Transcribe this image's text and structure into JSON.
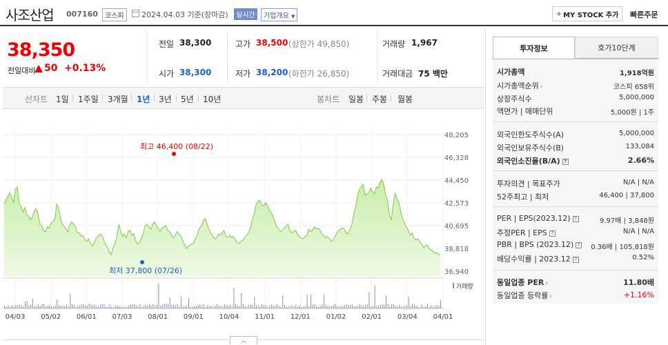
{
  "header": {
    "company_name": "사조산업",
    "code": "007160",
    "market": "코스피",
    "date_text": "2024.04.03  기준(장마감)",
    "realtime_label": "실시간",
    "overview_label": "기업개요",
    "mystock_label": "MY STOCK 추가",
    "quick_order_label": "빠른주문"
  },
  "price": {
    "current": "38,350",
    "change_label": "전일대비",
    "change_value": "50",
    "change_pct": "+0.13%"
  },
  "quote": {
    "prev_label": "전일",
    "prev": "38,300",
    "high_label": "고가",
    "high": "38,500",
    "upper_limit": "(상한가 49,850)",
    "volume_label": "거래량",
    "volume": "1,967",
    "open_label": "시가",
    "open": "38,300",
    "low_label": "저가",
    "low": "38,200",
    "lower_limit": "(하한가 26,850)",
    "amount_label": "거래대금",
    "amount": "75 백만"
  },
  "period": {
    "line_chart_label": "선차트",
    "line_items": [
      "1일",
      "1주일",
      "3개월",
      "1년",
      "3년",
      "5년",
      "10년"
    ],
    "selected": "1년",
    "candle_label": "봉차트",
    "candle_items": [
      "일봉",
      "주봉",
      "월봉"
    ]
  },
  "chart_data": {
    "type": "area",
    "y_ticks": [
      "48,205",
      "46,328",
      "44,450",
      "42,573",
      "40,695",
      "38,818",
      "36,940"
    ],
    "ylim": [
      36940,
      48205
    ],
    "x_ticks": [
      "04/03",
      "05/02",
      "06/01",
      "07/03",
      "08/01",
      "09/01",
      "10/04",
      "11/01",
      "12/01",
      "01/02",
      "02/01",
      "03/04",
      "04/01"
    ],
    "high_annotation": "최고 46,400 (08/22)",
    "low_annotation": "최저 37,800 (07/26)",
    "volume_label": "거래량",
    "series": [
      {
        "name": "price",
        "values": [
          42500,
          42800,
          43100,
          43400,
          43000,
          42600,
          43700,
          43900,
          42500,
          42300,
          41800,
          42200,
          41600,
          41500,
          41200,
          41400,
          41900,
          42100,
          41700,
          40800,
          40700,
          40300,
          40200,
          40600,
          40500,
          40900,
          41000,
          41300,
          42500,
          42100,
          41300,
          40800,
          40600,
          40400,
          40200,
          40800,
          41000,
          40800,
          40600,
          40100,
          40100,
          39800,
          39900,
          39500,
          39400,
          39600,
          39200,
          39000,
          39300,
          39700,
          39800,
          40000,
          39900,
          39500,
          39100,
          38900,
          38500,
          38300,
          38900,
          39200,
          39800,
          40800,
          40200,
          39800,
          40000,
          39700,
          40200,
          40300,
          39900,
          40000,
          39400,
          39200,
          39300,
          39600,
          40100,
          40700,
          40800,
          40600,
          40400,
          40800,
          41000,
          40700,
          40400,
          40200,
          40500,
          40600,
          40700,
          40300,
          40200,
          39900,
          39700,
          39900,
          40200,
          40000,
          39800,
          39500,
          39100,
          38800,
          39000,
          39100,
          39200,
          39300,
          39700,
          40100,
          40500,
          40700,
          41100,
          41300,
          40800,
          40400,
          40100,
          39800,
          39600,
          39700,
          40000,
          39900,
          40100,
          40300,
          39800,
          39700,
          39900,
          39700,
          39800,
          39500,
          39300,
          39200,
          39400,
          39500,
          39700,
          39900,
          40100,
          40500,
          41200,
          41600,
          42400,
          42700,
          42800,
          42400,
          42300,
          42600,
          42400,
          42000,
          41800,
          41500,
          41000,
          40600,
          40400,
          40200,
          40300,
          40500,
          40700,
          40800,
          40300,
          40100,
          40200,
          40300,
          40000,
          39800,
          39700,
          39600,
          39800,
          39900,
          40400,
          40200,
          40300,
          40600,
          40400,
          40500,
          40300,
          40000,
          39900,
          39700,
          39800,
          39600,
          39400,
          39500,
          39800,
          40100,
          40300,
          40400,
          40500,
          40400,
          40100,
          40000,
          40400,
          40800,
          41700,
          42200,
          43200,
          43700,
          43900,
          44100,
          43200,
          43300,
          43400,
          43800,
          43500,
          43300,
          43900,
          43800,
          44300,
          44500,
          44000,
          43200,
          42700,
          41500,
          41200,
          42500,
          43400,
          42900,
          42600,
          41800,
          41300,
          40900,
          40600,
          40300,
          39900,
          40100,
          39700,
          39500,
          39600,
          39400,
          39200,
          38900,
          39000,
          39100,
          38800,
          38700,
          38600,
          38400,
          38500,
          38300,
          38350
        ]
      }
    ]
  },
  "info": {
    "tab_invest": "투자정보",
    "tab_hoga": "호가10단계",
    "mktcap_label": "시가총액",
    "mktcap": "1,918억원",
    "mktcap_rank_label": "시가총액순위",
    "mktcap_rank": "코스피 658위",
    "shares_label": "상장주식수",
    "shares": "5,000,000",
    "par_label": "액면가 | 매매단위",
    "par": "5,000원 | 1주",
    "foreign_limit_label": "외국인한도주식수(A)",
    "foreign_limit": "5,000,000",
    "foreign_hold_label": "외국인보유주식수(B)",
    "foreign_hold": "133,084",
    "foreign_rate_label": "외국인소진율(B/A)",
    "foreign_rate": "2.66%",
    "opinion_label": "투자의견 | 목표주가",
    "opinion": "N/A | N/A",
    "w52_label": "52주최고 | 최저",
    "w52": "46,400 | 37,800",
    "per_label": "PER | EPS(2023.12)",
    "per": "9.97배 | 3,848원",
    "est_label": "추정PER | EPS",
    "est": "N/A | N/A",
    "pbr_label": "PBR | BPS (2023.12)",
    "pbr": "0.36배 | 105,818원",
    "div_label": "배당수익률 | 2023.12",
    "div": "0.52%",
    "ind_per_label": "동일업종 PER",
    "ind_per": "11.80배",
    "ind_chg_label": "동일업종 등락률",
    "ind_chg": "+1.16%"
  }
}
